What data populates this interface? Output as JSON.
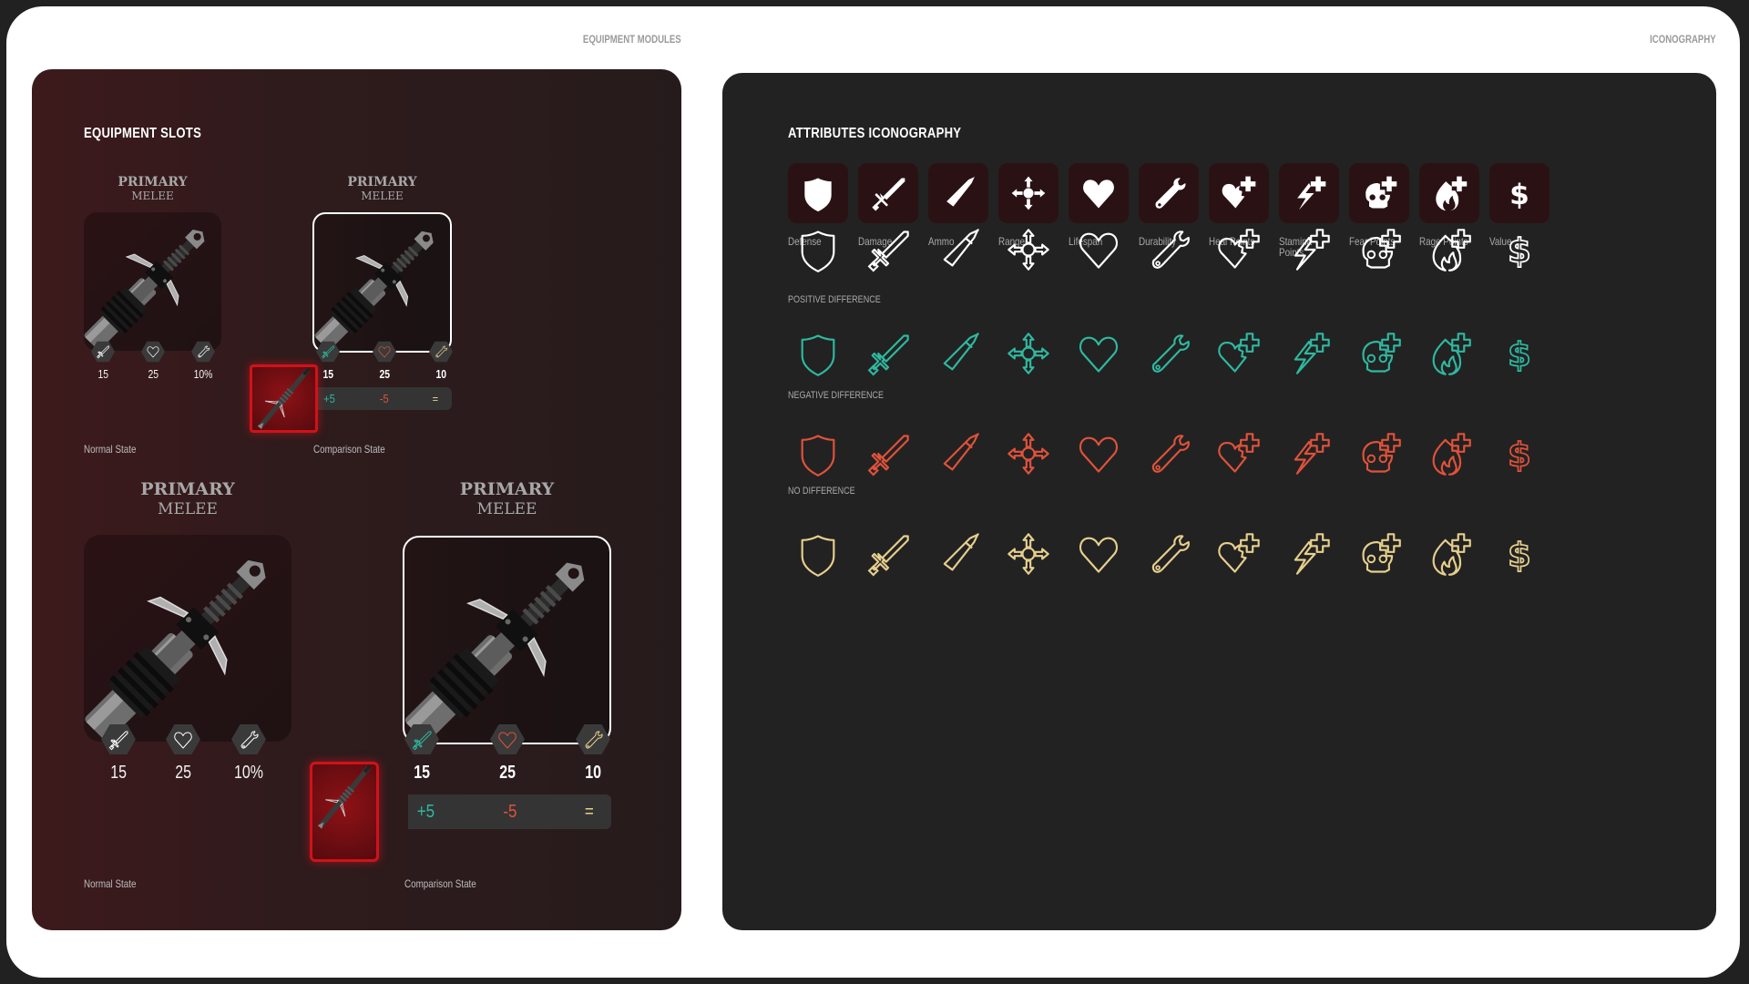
{
  "section_labels": {
    "left": "EQUIPMENT MODULES",
    "right": "ICONOGRAPHY"
  },
  "equipment": {
    "heading": "EQUIPMENT SLOTS",
    "small": {
      "normal": {
        "title": "PRIMARY",
        "subtitle": "MELEE",
        "stats": [
          {
            "icon": "sword-icon",
            "value": "15"
          },
          {
            "icon": "heart-icon",
            "value": "25"
          },
          {
            "icon": "wrench-icon",
            "value": "10%"
          }
        ],
        "caption": "Normal State"
      },
      "comparison": {
        "title": "PRIMARY",
        "subtitle": "MELEE",
        "stats": [
          {
            "icon": "sword-icon",
            "value": "15",
            "state": "positive"
          },
          {
            "icon": "heart-icon",
            "value": "25",
            "state": "negative"
          },
          {
            "icon": "wrench-icon",
            "value": "10",
            "state": "neutral"
          }
        ],
        "deltas": [
          "+5",
          "-5",
          "="
        ],
        "caption": "Comparison State"
      }
    },
    "large": {
      "normal": {
        "title": "PRIMARY",
        "subtitle": "MELEE",
        "stats": [
          {
            "icon": "sword-icon",
            "value": "15"
          },
          {
            "icon": "heart-icon",
            "value": "25"
          },
          {
            "icon": "wrench-icon",
            "value": "10%"
          }
        ],
        "caption": "Normal State"
      },
      "comparison": {
        "title": "PRIMARY",
        "subtitle": "MELEE",
        "stats": [
          {
            "icon": "sword-icon",
            "value": "15",
            "state": "positive"
          },
          {
            "icon": "heart-icon",
            "value": "25",
            "state": "negative"
          },
          {
            "icon": "wrench-icon",
            "value": "10",
            "state": "neutral"
          }
        ],
        "deltas": [
          "+5",
          "-5",
          "="
        ],
        "caption": "Comparison State"
      }
    }
  },
  "iconography": {
    "heading": "ATTRIBUTES ICONOGRAPHY",
    "attributes": [
      {
        "id": "defense",
        "label": "Defense"
      },
      {
        "id": "damage",
        "label": "Damage"
      },
      {
        "id": "ammo",
        "label": "Ammo"
      },
      {
        "id": "range",
        "label": "Range"
      },
      {
        "id": "lifespan",
        "label": "Lifespan"
      },
      {
        "id": "durability",
        "label": "Durability"
      },
      {
        "id": "heal",
        "label": "Heal Points"
      },
      {
        "id": "stamina",
        "label": "Stamina Points"
      },
      {
        "id": "fear",
        "label": "Fear Points"
      },
      {
        "id": "rage",
        "label": "Rage Points"
      },
      {
        "id": "value",
        "label": "Value"
      }
    ],
    "rows": [
      {
        "key": "default",
        "label": "",
        "color": "#ffffff"
      },
      {
        "key": "positive",
        "label": "POSITIVE DIFFERENCE",
        "color": "#2fb8a0"
      },
      {
        "key": "negative",
        "label": "NEGATIVE DIFFERENCE",
        "color": "#e0523b"
      },
      {
        "key": "none",
        "label": "NO DIFFERENCE",
        "color": "#e6cf8e"
      }
    ]
  },
  "colors": {
    "positive": "#2fb8a0",
    "negative": "#e0523b",
    "neutral": "#e6cf8e",
    "default": "#ffffff",
    "tile_bg": "#2a1214",
    "selection_red": "#d0121a"
  }
}
